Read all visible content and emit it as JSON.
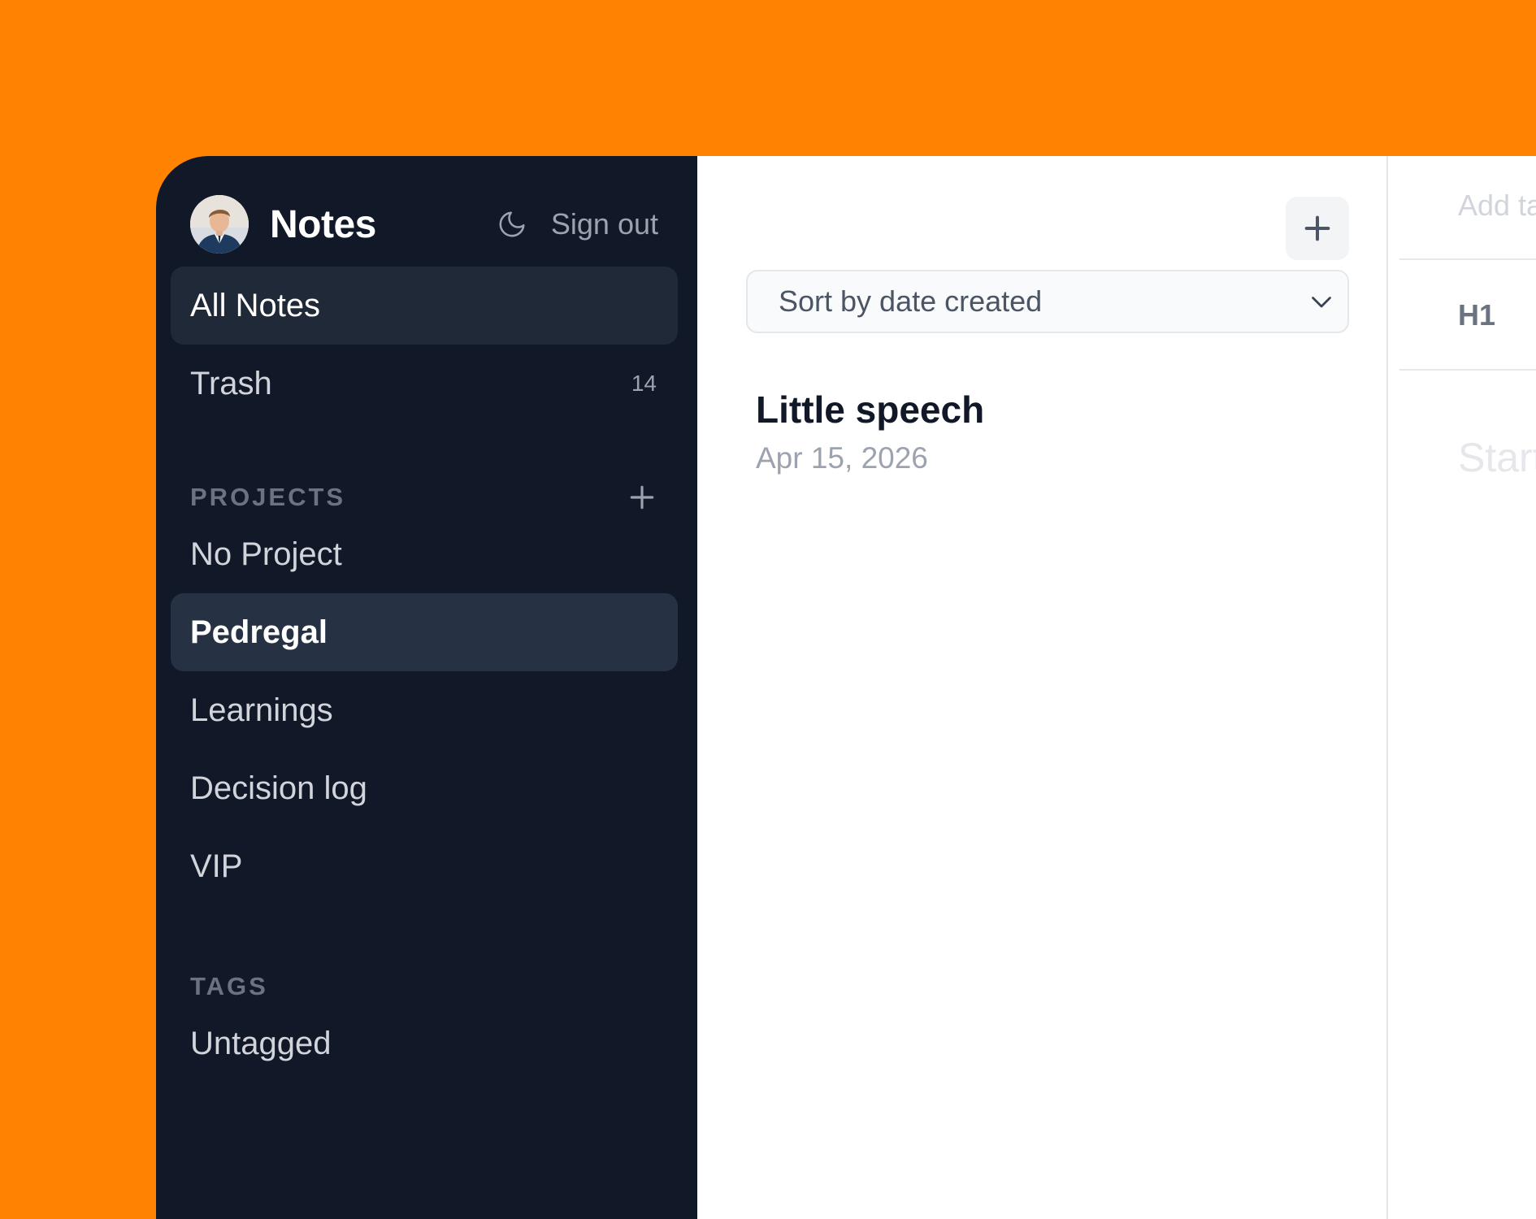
{
  "colors": {
    "background": "#FF8300",
    "sidebar": "#111827",
    "sidebar_active": "#1F2937",
    "text_white": "#FFFFFF",
    "text_muted": "#9CA3AF"
  },
  "sidebar": {
    "app_title": "Notes",
    "avatar_icon": "user-avatar",
    "theme_icon": "moon-icon",
    "sign_out_label": "Sign out",
    "nav": [
      {
        "label": "All Notes",
        "count": "",
        "active": true
      },
      {
        "label": "Trash",
        "count": "14",
        "active": false
      }
    ],
    "projects_heading": "PROJECTS",
    "add_project_icon": "plus-icon",
    "projects": [
      {
        "label": "No Project",
        "active": false
      },
      {
        "label": "Pedregal",
        "active": true
      },
      {
        "label": "Learnings",
        "active": false
      },
      {
        "label": "Decision log",
        "active": false
      },
      {
        "label": "VIP",
        "active": false
      }
    ],
    "tags_heading": "TAGS",
    "tags": [
      {
        "label": "Untagged",
        "active": false
      }
    ]
  },
  "note_list": {
    "new_note_icon": "plus-icon",
    "sort_label": "Sort by date created",
    "sort_icon": "chevron-down-icon",
    "notes": [
      {
        "title": "Little speech",
        "date": "Apr 15, 2026"
      }
    ]
  },
  "editor": {
    "tags_placeholder": "Add ta",
    "toolbar_h1": "H1",
    "body_placeholder": "Start"
  }
}
